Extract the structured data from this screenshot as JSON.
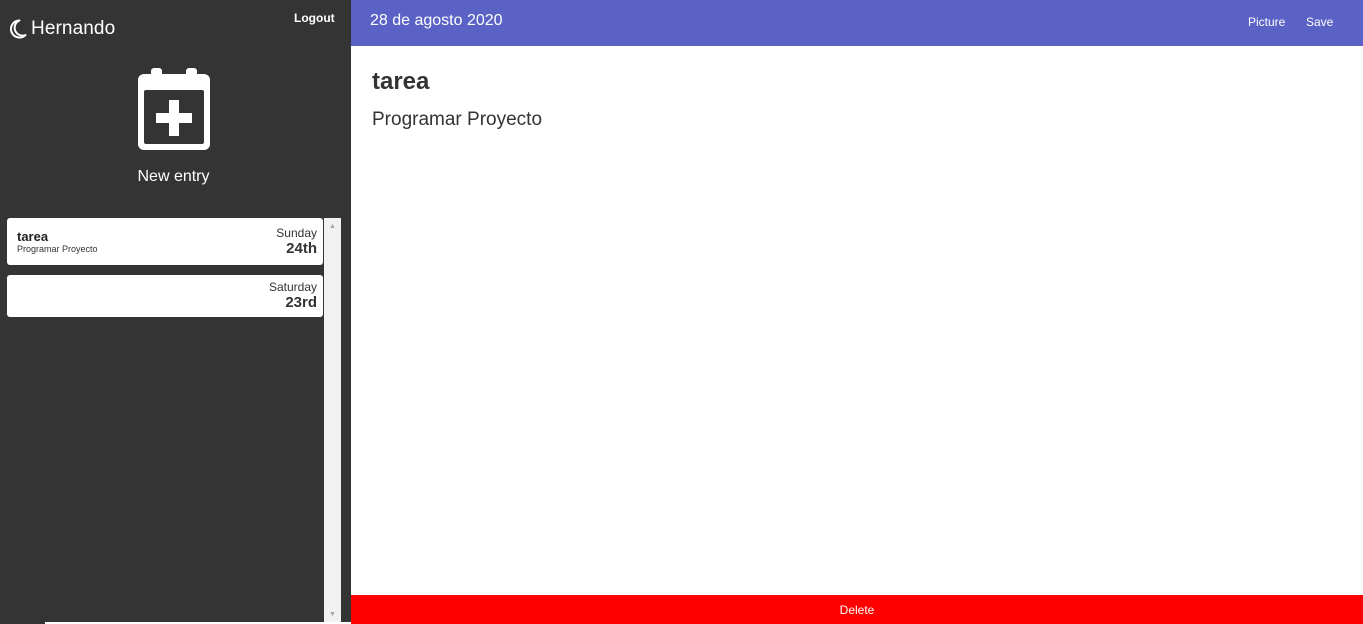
{
  "sidebar": {
    "brand": {
      "name": "Hernando",
      "icon": "moon-icon"
    },
    "logout_label": "Logout",
    "new_entry": {
      "label": "New entry",
      "icon": "calendar-plus-icon"
    },
    "entries": [
      {
        "title": "tarea",
        "subtitle": "Programar Proyecto",
        "weekday": "Sunday",
        "day": "24th"
      },
      {
        "title": "",
        "subtitle": "",
        "weekday": "Saturday",
        "day": "23rd"
      }
    ],
    "scrollbar": {
      "up_glyph": "▲",
      "down_glyph": "▼"
    }
  },
  "header": {
    "date": "28 de agosto 2020",
    "picture_label": "Picture",
    "save_label": "Save",
    "color": "#5a62c6"
  },
  "editor": {
    "title": "tarea",
    "body": "Programar Proyecto"
  },
  "footer": {
    "delete_label": "Delete",
    "color": "#ff0000"
  }
}
